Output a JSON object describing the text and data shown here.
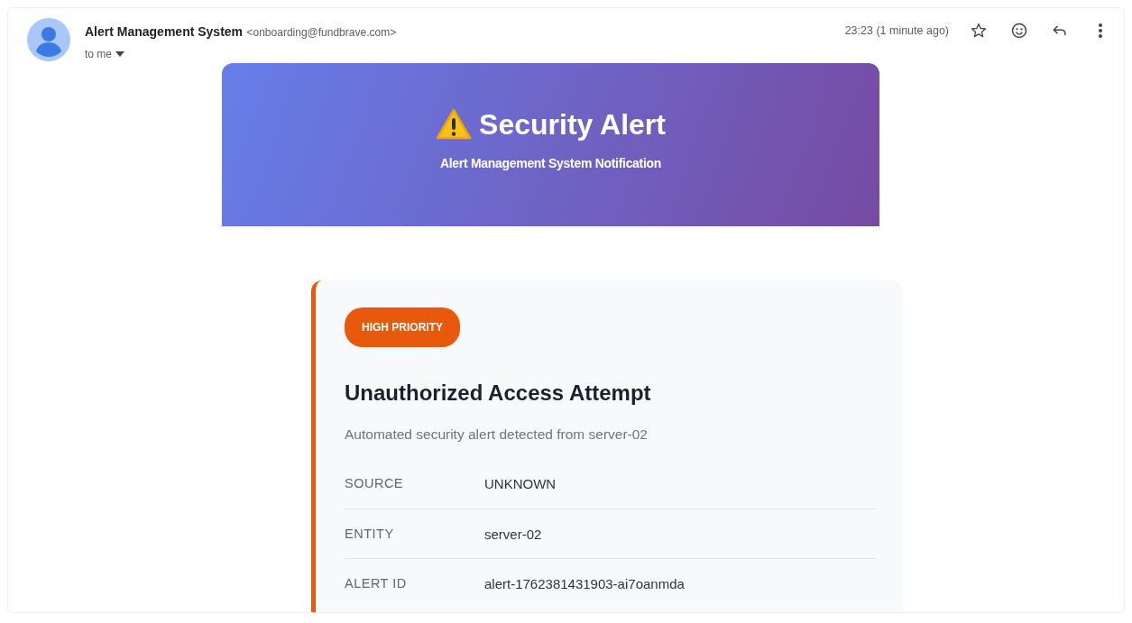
{
  "sender": {
    "name": "Alert Management System",
    "email": "<onboarding@fundbrave.com>",
    "recipient": "to me"
  },
  "time": "23:23 (1 minute ago)",
  "banner": {
    "title": "Security Alert",
    "subtitle": "Alert Management System Notification"
  },
  "alert": {
    "badge": "HIGH PRIORITY",
    "title": "Unauthorized Access Attempt",
    "description": "Automated security alert detected from server-02",
    "fields": [
      {
        "label": "SOURCE",
        "value": "UNKNOWN"
      },
      {
        "label": "ENTITY",
        "value": "server-02"
      },
      {
        "label": "ALERT ID",
        "value": "alert-1762381431903-ai7oanmda"
      }
    ]
  }
}
